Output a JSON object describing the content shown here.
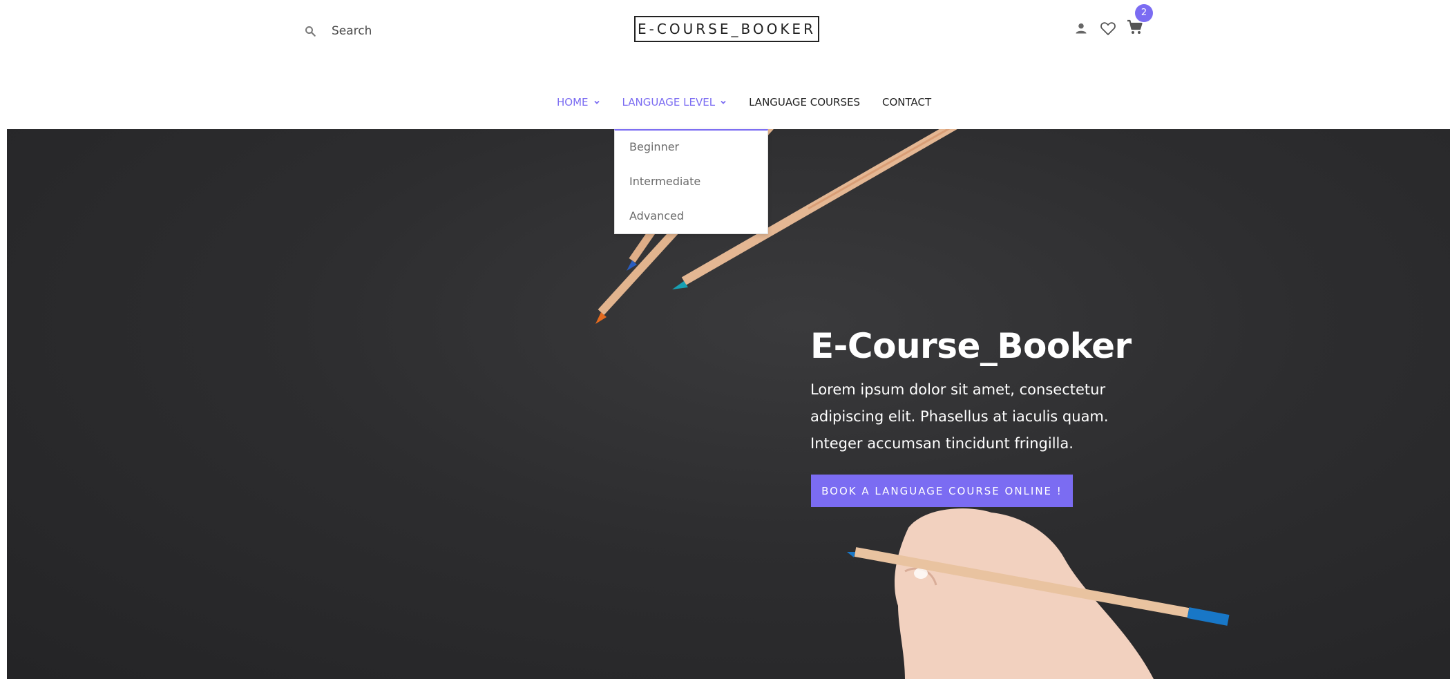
{
  "header": {
    "search_placeholder": "Search",
    "logo_text": "E-COURSE_BOOKER",
    "cart_count": "2",
    "icons": [
      "search-icon",
      "user-icon",
      "heart-icon",
      "cart-icon"
    ]
  },
  "nav": {
    "items": [
      {
        "label": "HOME",
        "has_dropdown": true,
        "active": true
      },
      {
        "label": "LANGUAGE LEVEL",
        "has_dropdown": true,
        "active": true
      },
      {
        "label": "LANGUAGE COURSES",
        "has_dropdown": false,
        "active": false
      },
      {
        "label": "CONTACT",
        "has_dropdown": false,
        "active": false
      }
    ]
  },
  "dropdown": {
    "items": [
      "Beginner",
      "Intermediate",
      "Advanced"
    ]
  },
  "hero": {
    "title": "E-Course_Booker",
    "text": "Lorem ipsum dolor sit amet, consectetur adipiscing elit. Phasellus at iaculis quam. Integer accumsan tincidunt fringilla.",
    "button_label": "BOOK A LANGUAGE COURSE ONLINE !"
  },
  "colors": {
    "accent": "#7b6cf2",
    "hero_background": "#2d2d2f",
    "text_dark": "#222222"
  }
}
